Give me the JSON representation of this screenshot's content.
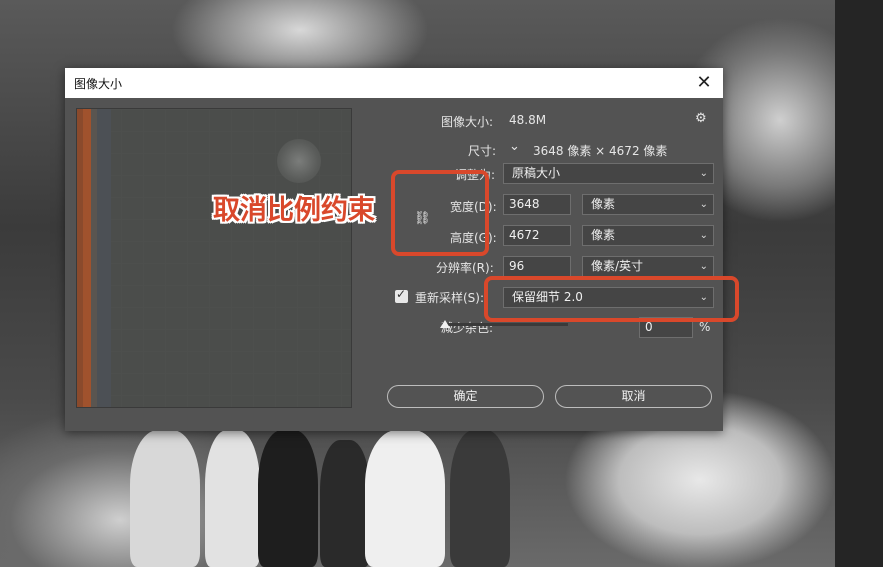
{
  "dialog": {
    "title": "图像大小",
    "close_glyph": "✕"
  },
  "info": {
    "image_size_label": "图像大小:",
    "image_size_value": "48.8M",
    "dimensions_label": "尺寸:",
    "dimensions_value": "3648 像素  ×  4672 像素",
    "fit_to_label": "调整为:",
    "fit_to_value": "原稿大小"
  },
  "width": {
    "label": "宽度(D):",
    "value": "3648",
    "unit": "像素"
  },
  "height": {
    "label": "高度(G):",
    "value": "4672",
    "unit": "像素"
  },
  "resolution": {
    "label": "分辨率(R):",
    "value": "96",
    "unit": "像素/英寸"
  },
  "resample": {
    "label": "重新采样(S):",
    "checked": true,
    "method": "保留细节 2.0"
  },
  "noise": {
    "label": "减少杂色:",
    "value": "0",
    "unit": "%"
  },
  "buttons": {
    "ok": "确定",
    "cancel": "取消"
  },
  "annotation": {
    "text": "取消比例约束"
  },
  "icons": {
    "gear": "⚙",
    "chevron": "⌄",
    "link": "⛓",
    "check": "✓"
  },
  "colors": {
    "annotation_red": "#d9482b",
    "dialog_bg": "#535353"
  }
}
